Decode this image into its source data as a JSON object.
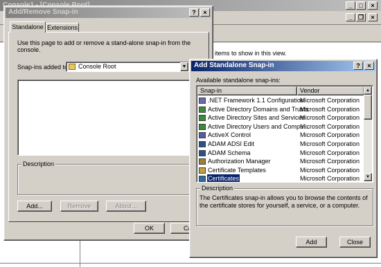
{
  "background": {
    "console_title": "Console1 - [Console Root]",
    "hint_text": "items to show in this view."
  },
  "snapin_dialog": {
    "title": "Add/Remove Snap-in",
    "tabs": [
      {
        "label": "Standalone"
      },
      {
        "label": "Extensions"
      }
    ],
    "instruction": "Use this page to add or remove a stand-alone snap-in from the console.",
    "snapins_added_to_label": "Snap-ins added to:",
    "snapins_added_to_value": "Console Root",
    "description_label": "Description",
    "buttons": {
      "add": "Add...",
      "remove": "Remove",
      "about": "About...",
      "ok": "OK",
      "cancel": "Ca"
    }
  },
  "standalone_dialog": {
    "title": "Add Standalone Snap-in",
    "available_label": "Available standalone snap-ins:",
    "columns": {
      "snapin": "Snap-in",
      "vendor": "Vendor"
    },
    "rows": [
      {
        "name": ".NET Framework 1.1 Configuration",
        "vendor": "Microsoft Corporation",
        "icon": "net-framework-icon"
      },
      {
        "name": "Active Directory Domains and Trusts",
        "vendor": "Microsoft Corporation",
        "icon": "ad-domains-icon"
      },
      {
        "name": "Active Directory Sites and Services",
        "vendor": "Microsoft Corporation",
        "icon": "ad-sites-icon"
      },
      {
        "name": "Active Directory Users and Compu...",
        "vendor": "Microsoft Corporation",
        "icon": "ad-users-icon"
      },
      {
        "name": "ActiveX Control",
        "vendor": "Microsoft Corporation",
        "icon": "activex-icon"
      },
      {
        "name": "ADAM ADSI Edit",
        "vendor": "Microsoft Corporation",
        "icon": "adsi-edit-icon"
      },
      {
        "name": "ADAM Schema",
        "vendor": "Microsoft Corporation",
        "icon": "schema-icon"
      },
      {
        "name": "Authorization Manager",
        "vendor": "Microsoft Corporation",
        "icon": "authorization-icon"
      },
      {
        "name": "Certificate Templates",
        "vendor": "Microsoft Corporation",
        "icon": "certificate-templates-icon"
      },
      {
        "name": "Certificates",
        "vendor": "Microsoft Corporation",
        "icon": "certificates-icon",
        "selected": true
      }
    ],
    "description_label": "Description",
    "description_text": "The Certificates snap-in allows you to browse the contents of the certificate stores for yourself, a service, or a computer.",
    "buttons": {
      "add": "Add",
      "close": "Close"
    }
  },
  "colors": {
    "title_active": "#0a246a",
    "title_inactive": "#808080",
    "selection": "#0a246a",
    "face": "#d4d0c8"
  }
}
